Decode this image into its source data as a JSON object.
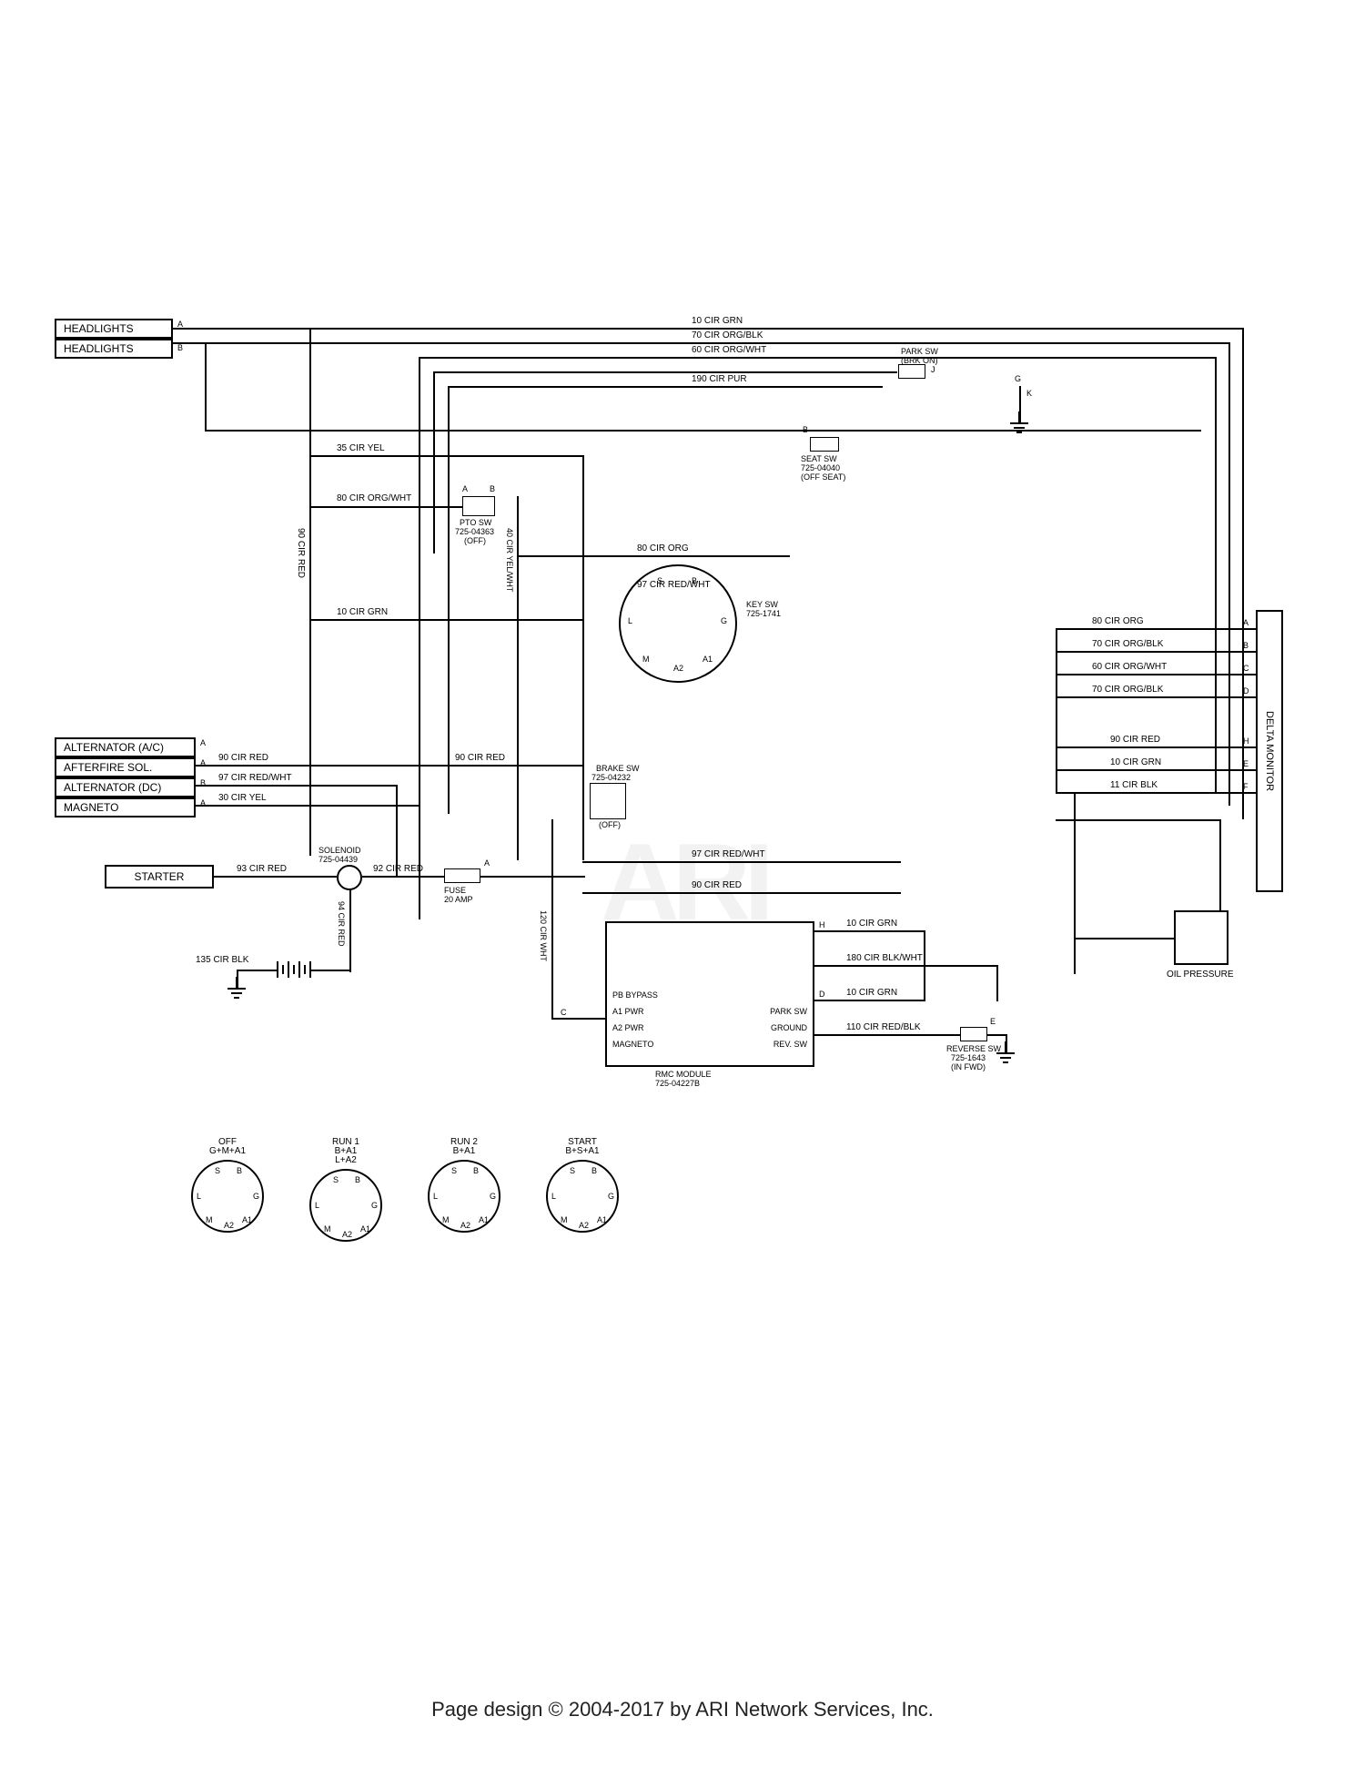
{
  "components": {
    "headlights_a": "HEADLIGHTS",
    "headlights_b": "HEADLIGHTS",
    "alternator_ac": "ALTERNATOR (A/C)",
    "afterfire_sol": "AFTERFIRE SOL.",
    "alternator_dc": "ALTERNATOR (DC)",
    "magneto": "MAGNETO",
    "starter": "STARTER",
    "delta_monitor": "DELTA MONITOR",
    "oil_pressure": "OIL PRESSURE"
  },
  "switches": {
    "pto_sw": {
      "name": "PTO SW",
      "part": "725-04363",
      "state": "(OFF)"
    },
    "seat_sw": {
      "name": "SEAT SW",
      "part": "725-04040",
      "state": "(OFF SEAT)"
    },
    "key_sw": {
      "name": "KEY SW",
      "part": "725-1741"
    },
    "brake_sw": {
      "name": "BRAKE SW",
      "part": "725-04232",
      "state": "(OFF)"
    },
    "park_sw": {
      "name": "PARK SW",
      "state": "(BRK ON)"
    },
    "reverse_sw": {
      "name": "REVERSE SW",
      "part": "725-1643",
      "state": "(IN FWD)"
    },
    "solenoid": {
      "name": "SOLENOID",
      "part": "725-04439"
    },
    "fuse": {
      "name": "FUSE",
      "amp": "20 AMP"
    },
    "rmc_module": {
      "name": "RMC MODULE",
      "part": "725-04227B"
    }
  },
  "rmc_pins": {
    "pb_bypass": "PB BYPASS",
    "a1_pwr": "A1 PWR",
    "a2_pwr": "A2 PWR",
    "park_sw": "PARK SW",
    "ground": "GROUND",
    "magneto": "MAGNETO",
    "rev_sw": "REV. SW"
  },
  "wires": {
    "w10_grn_top": "10 CIR GRN",
    "w70_orgblk": "70 CIR ORG/BLK",
    "w60_orgwht": "60 CIR ORG/WHT",
    "w190_pur": "190 CIR PUR",
    "w35_yel": "35 CIR YEL",
    "w80_orgwht": "80 CIR ORG/WHT",
    "w40_yelwht": "40 CIR YEL/WHT",
    "w80_org": "80 CIR ORG",
    "w97_redwht": "97 CIR RED/WHT",
    "w10_grn_mid": "10 CIR GRN",
    "w90_red_a": "90 CIR RED",
    "w90_red_b": "90 CIR RED",
    "w97_redwht_b": "97 CIR RED/WHT",
    "w30_yel": "30 CIR YEL",
    "w93_red": "93 CIR RED",
    "w92_red": "92 CIR RED",
    "w94_red": "94 CIR RED",
    "w135_blk": "135 CIR BLK",
    "w120_wht": "120 CIR WHT",
    "w90_red_vert": "90 CIR RED",
    "w80_org_r": "80 CIR ORG",
    "w70_orgblk_r": "70 CIR ORG/BLK",
    "w60_orgwht_r": "60 CIR ORG/WHT",
    "w70_orgblk_r2": "70 CIR ORG/BLK",
    "w90_red_r": "90 CIR RED",
    "w10_grn_r": "10 CIR GRN",
    "w11_blk_r": "11 CIR BLK",
    "w10_grn_h": "10 CIR GRN",
    "w180_blkwht": "180 CIR BLK/WHT",
    "w10_grn_d": "10 CIR GRN",
    "w110_redblk": "110 CIR RED/BLK",
    "w97_redwht_c": "97 CIR RED/WHT",
    "w90_red_c": "90 CIR RED"
  },
  "key_positions": {
    "pins": [
      "S",
      "B",
      "L",
      "G",
      "M",
      "A1",
      "A2"
    ],
    "off": {
      "label": "OFF",
      "combo": "G+M+A1"
    },
    "run1": {
      "label": "RUN 1",
      "combo": "B+A1\nL+A2"
    },
    "run2": {
      "label": "RUN 2",
      "combo": "B+A1"
    },
    "start": {
      "label": "START",
      "combo": "B+S+A1"
    }
  },
  "delta_pins": {
    "A": "A",
    "B": "B",
    "C": "C",
    "D": "D",
    "H": "H",
    "E": "E",
    "F": "F"
  },
  "terminals": {
    "A": "A",
    "B": "B",
    "C": "C",
    "D": "D",
    "E": "E",
    "F": "F",
    "G": "G",
    "H": "H",
    "J": "J",
    "K": "K",
    "S": "S",
    "L": "L",
    "M": "M"
  },
  "footer": "Page design © 2004-2017 by ARI Network Services, Inc.",
  "watermark": "ARI"
}
